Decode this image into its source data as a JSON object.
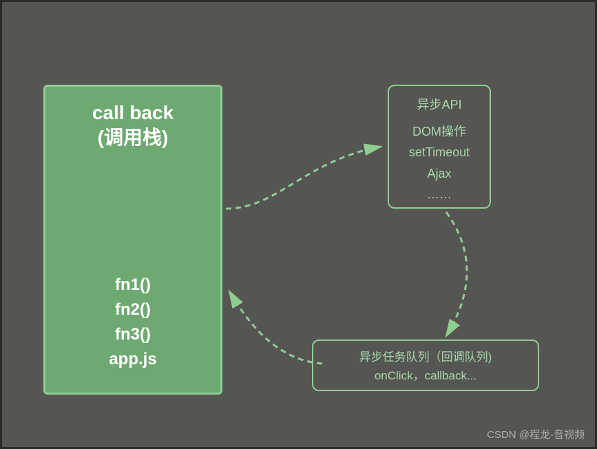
{
  "callstack": {
    "title_line1": "call back",
    "title_line2": "(调用栈)",
    "items": [
      "fn1()",
      "fn2()",
      "fn3()",
      "app.js"
    ]
  },
  "async_api": {
    "title": "异步API",
    "items": [
      "DOM操作",
      "setTimeout",
      "Ajax",
      "……"
    ]
  },
  "queue": {
    "title": "异步任务队列（回调队列)",
    "items": "onClick，callback..."
  },
  "watermark": "CSDN @程龙-音视频",
  "colors": {
    "bg": "#555552",
    "box_fill": "#6ea971",
    "box_border": "#8fce92",
    "text_light": "#a8d8aa"
  }
}
